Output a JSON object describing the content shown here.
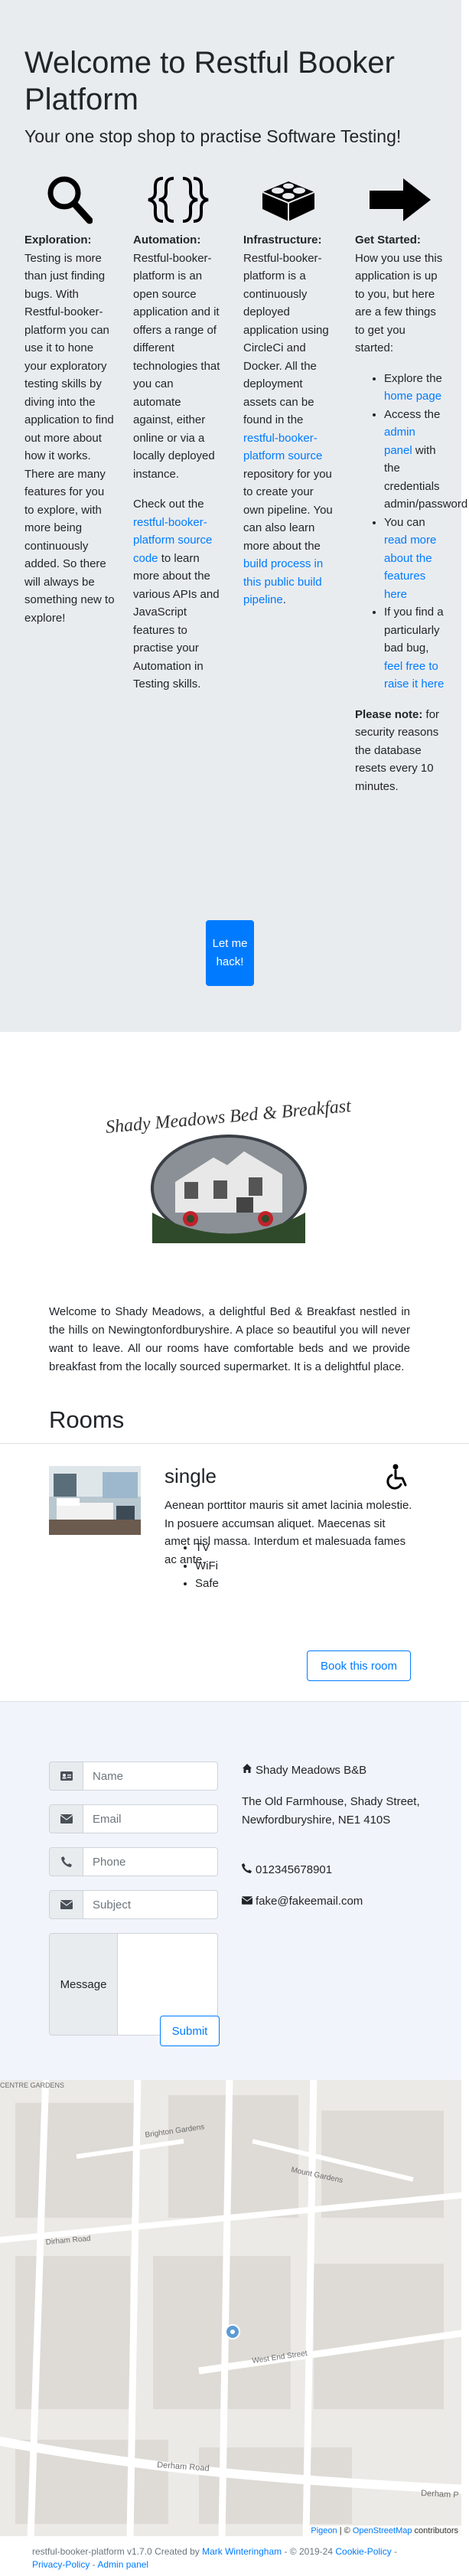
{
  "hero": {
    "title": "Welcome to Restful Booker Platform",
    "subtitle": "Your one stop shop to practise Software Testing!"
  },
  "columns": {
    "exploration": {
      "icon": "magnifier-icon",
      "heading": "Exploration:",
      "text": "Testing is more than just finding bugs. With Restful-booker-platform you can use it to hone your exploratory testing skills by diving into the application to find out more about how it works. There are many features for you to explore, with more being continuously added. So there will always be something new to explore!"
    },
    "automation": {
      "icon": "curly-braces-icon",
      "heading": "Automation:",
      "text": "Restful-booker-platform is an open source application and it offers a range of different technologies that you can automate against, either online or via a locally deployed instance.",
      "text2_pre": "Check out the ",
      "link": "restful-booker-platform source code",
      "text2_post": " to learn more about the various APIs and JavaScript features to practise your Automation in Testing skills."
    },
    "infrastructure": {
      "icon": "lego-brick-icon",
      "heading": "Infrastructure:",
      "text_pre": "Restful-booker-platform is a continuously deployed application using CircleCi and Docker. All the deployment assets can be found in the ",
      "link1": "restful-booker-platform source",
      "text_mid": " repository for you to create your own pipeline. You can also learn more about the ",
      "link2": "build process in this public build pipeline",
      "text_post": "."
    },
    "get_started": {
      "icon": "arrow-right-icon",
      "heading": "Get Started:",
      "text": "How you use this application is up to you, but here are a few things to get you started:",
      "item1_pre": "Explore the ",
      "item1_link": "home page",
      "item2_pre": "Access the ",
      "item2_link": "admin panel",
      "item2_post": " with the credentials admin/password",
      "item3_pre": "You can ",
      "item3_link": "read more about the features here",
      "item4_pre": "If you find a particularly bad bug, ",
      "item4_link": "feel free to raise it here",
      "note_heading": "Please note:",
      "note_text": " for security reasons the database resets every 10 minutes."
    }
  },
  "hack_button": "Let me hack!",
  "logo": {
    "text": "Shady Meadows Bed & Breakfast"
  },
  "intro": "Welcome to Shady Meadows, a delightful Bed & Breakfast nestled in the hills on Newingtonfordburyshire. A place so beautiful you will never want to leave. All our rooms have comfortable beds and we provide breakfast from the locally sourced supermarket. It is a delightful place.",
  "rooms": {
    "heading": "Rooms",
    "room": {
      "name": "single",
      "description": "Aenean porttitor mauris sit amet lacinia molestie. In posuere accumsan aliquet. Maecenas sit amet nisl massa. Interdum et malesuada fames ac ante.",
      "features": [
        "TV",
        "WiFi",
        "Safe"
      ],
      "book_label": "Book this room"
    }
  },
  "contact": {
    "name_placeholder": "Name",
    "email_placeholder": "Email",
    "phone_placeholder": "Phone",
    "subject_placeholder": "Subject",
    "message_label": "Message",
    "submit_label": "Submit",
    "business_name": "Shady Meadows B&B",
    "address": "The Old Farmhouse, Shady Street, Newfordburyshire, NE1 410S",
    "phone": "012345678901",
    "email": "fake@fakeemail.com"
  },
  "map": {
    "streets": [
      "CENTRE GARDENS",
      "Brighton Gardens",
      "Mount Gardens",
      "Dirham Road",
      "West End Street",
      "Derham Road",
      "Derham P"
    ],
    "attribution_link1": "Pigeon",
    "attribution_sep": " | © ",
    "attribution_link2": "OpenStreetMap",
    "attribution_post": " contributors"
  },
  "footer": {
    "text": "restful-booker-platform v1.7.0 Created by ",
    "author": "Mark Winteringham",
    "years": " - © 2019-24 ",
    "cookie": "Cookie-Policy",
    "privacy": "Privacy-Policy",
    "admin": "Admin panel",
    "sep": " - "
  },
  "colors": {
    "primary": "#007bff",
    "jumbotron": "#e9ecef",
    "contact_bg": "#f1f5fb"
  }
}
